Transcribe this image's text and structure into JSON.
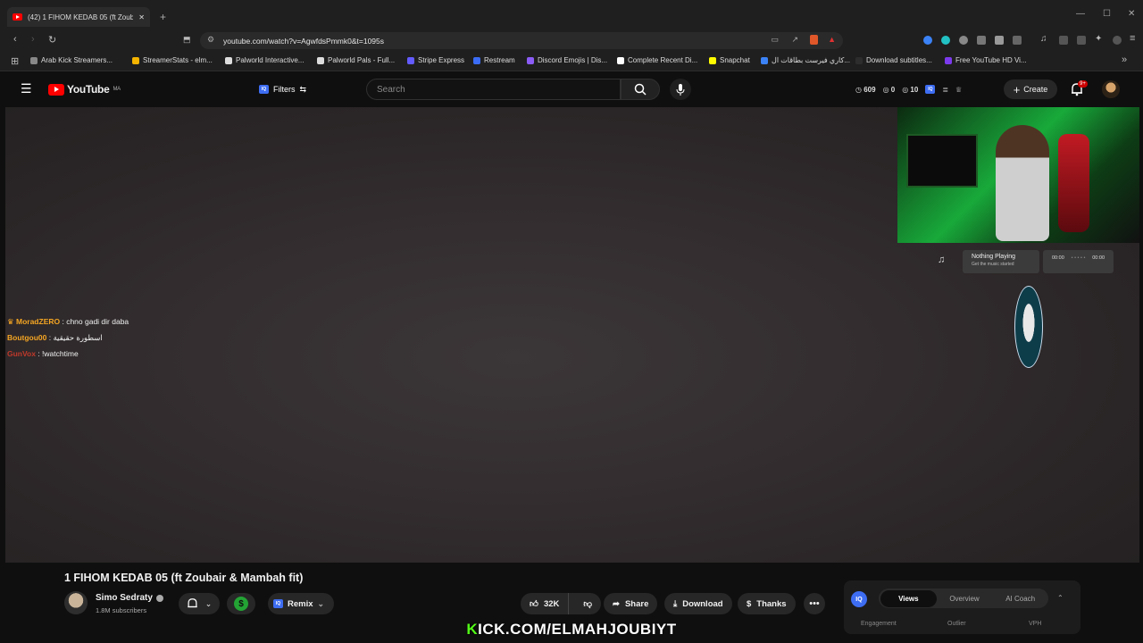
{
  "browser": {
    "tab_title": "(42) 1 FIHOM KEDAB 05 (ft Zoubi",
    "url": "youtube.com/watch?v=AgwfdsPmmk0&t=1095s",
    "bookmarks": [
      {
        "label": "Arab Kick Streamers...",
        "color": "#888888"
      },
      {
        "label": "StreamerStats - elm...",
        "color": "#f5b400"
      },
      {
        "label": "Palworld Interactive...",
        "color": "#dddddd"
      },
      {
        "label": "Palworld Pals - Full...",
        "color": "#dddddd"
      },
      {
        "label": "Stripe Express",
        "color": "#635bff"
      },
      {
        "label": "Restream",
        "color": "#3b6cf6"
      },
      {
        "label": "Discord Emojis | Dis...",
        "color": "#8b5cf6"
      },
      {
        "label": "Complete Recent Di...",
        "color": "#ffffff"
      },
      {
        "label": "Snapchat",
        "color": "#fffc00"
      },
      {
        "label": "كاري فيرست بطاقات ال...",
        "color": "#3b82f6"
      },
      {
        "label": "Download subtitles...",
        "color": "#2d2d2d"
      },
      {
        "label": "Free YouTube HD Vi...",
        "color": "#7c3aed"
      }
    ]
  },
  "youtube": {
    "logo_text": "YouTube",
    "country_code": "MA",
    "filters_label": "Filters",
    "search_placeholder": "Search",
    "stats": {
      "views": "609",
      "likes": "0",
      "comments": "10"
    },
    "create_label": "Create",
    "notification_count": "9+"
  },
  "overlay": {
    "now_playing_title": "Nothing Playing",
    "now_playing_sub": "Get the music started",
    "time_start": "00:00",
    "time_end": "00:00",
    "chat": [
      {
        "user": "MoradZERO",
        "message": " : chno gadi dir daba",
        "color": "#f5a623"
      },
      {
        "user": "Boutgou00",
        "message": " : اسطورة حقيقية",
        "color": "#f5a623"
      },
      {
        "user": "GunVox",
        "message": " : !watchtime",
        "color": "#c0392b"
      }
    ],
    "kick_prefix": "K",
    "kick_rest": "ICK.COM/ELMAHJOUBIYT"
  },
  "video": {
    "title": "1 FIHOM KEDAB 05 (ft Zoubair & Mambah fit)",
    "channel": "Simo Sedraty",
    "subscribers": "1.8M subscribers",
    "remix_label": "Remix",
    "likes": "32K",
    "share_label": "Share",
    "download_label": "Download",
    "thanks_label": "Thanks"
  },
  "vidiq": {
    "tabs": [
      "Views",
      "Overview",
      "AI Coach"
    ],
    "sub_labels": [
      "Engagement",
      "Outlier",
      "VPH"
    ]
  }
}
